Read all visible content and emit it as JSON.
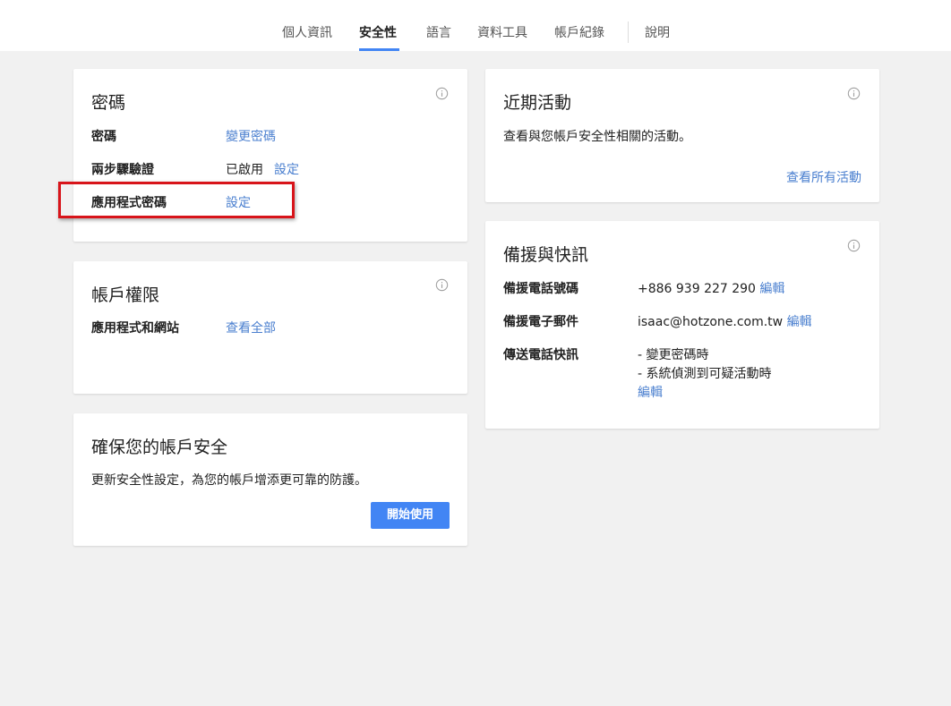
{
  "nav": {
    "tabs": [
      {
        "label": "個人資訊"
      },
      {
        "label": "安全性"
      },
      {
        "label": "語言"
      },
      {
        "label": "資料工具"
      },
      {
        "label": "帳戶紀錄"
      },
      {
        "label": "說明"
      }
    ],
    "active_tab": "安全性"
  },
  "password_card": {
    "title": "密碼",
    "rows": [
      {
        "label": "密碼",
        "link": "變更密碼"
      },
      {
        "label": "兩步驟驗證",
        "status": "已啟用",
        "link": "設定"
      },
      {
        "label": "應用程式密碼",
        "link": "設定"
      }
    ]
  },
  "permissions_card": {
    "title": "帳戶權限",
    "rows": [
      {
        "label": "應用程式和網站",
        "link": "查看全部"
      }
    ]
  },
  "secure_card": {
    "title": "確保您的帳戶安全",
    "description": "更新安全性設定，為您的帳戶增添更可靠的防護。",
    "button": "開始使用"
  },
  "activity_card": {
    "title": "近期活動",
    "description": "查看與您帳戶安全性相關的活動。",
    "link": "查看所有活動"
  },
  "recovery_card": {
    "title": "備援與快訊",
    "rows": [
      {
        "label": "備援電話號碼",
        "value": "+886 939 227 290",
        "link": "編輯"
      },
      {
        "label": "備援電子郵件",
        "value": "isaac@hotzone.com.tw",
        "link": "編輯"
      },
      {
        "label": "傳送電話快訊",
        "items": [
          "- 變更密碼時",
          "- 系統偵測到可疑活動時"
        ],
        "link": "編輯"
      }
    ]
  },
  "icons": {
    "info": "info-icon"
  },
  "colors": {
    "accent": "#4285f4",
    "link": "#4a7fcf",
    "highlight": "#d8141a",
    "background": "#f1f1f1"
  }
}
